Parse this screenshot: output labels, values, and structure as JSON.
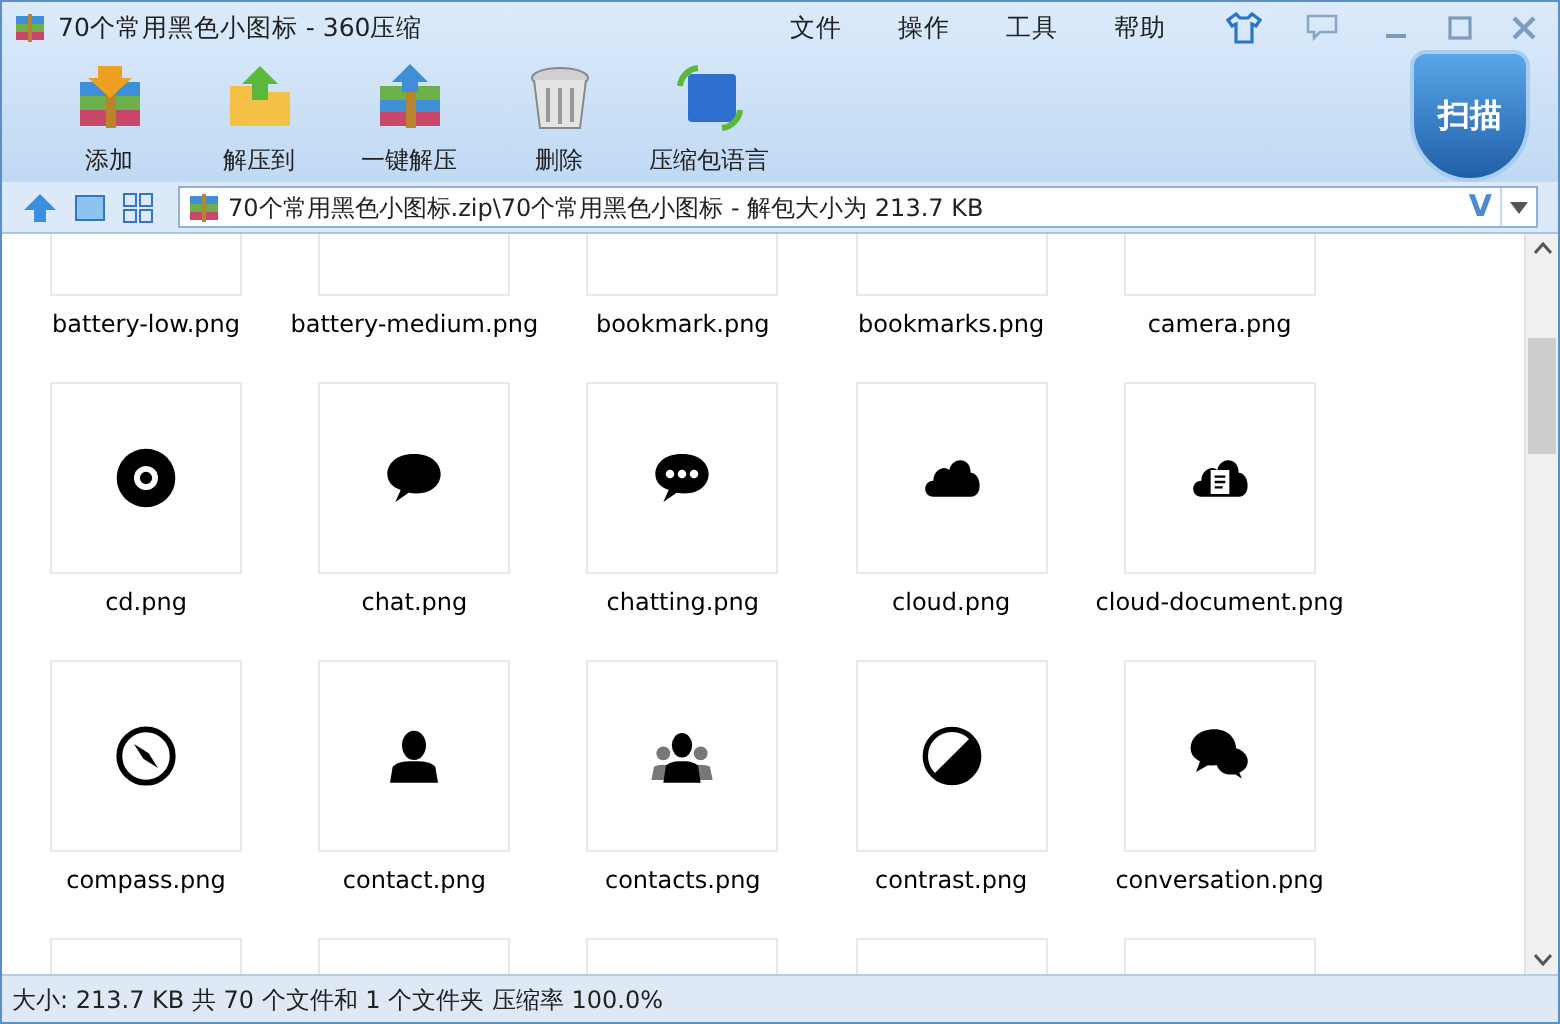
{
  "window": {
    "title": "70个常用黑色小图标 - 360压缩"
  },
  "menu": [
    "文件",
    "操作",
    "工具",
    "帮助"
  ],
  "toolbar": [
    {
      "label": "添加",
      "kind": "add"
    },
    {
      "label": "解压到",
      "kind": "extract_to"
    },
    {
      "label": "一键解压",
      "kind": "one_click"
    },
    {
      "label": "删除",
      "kind": "delete"
    },
    {
      "label": "压缩包语言",
      "kind": "language"
    }
  ],
  "scan_button": {
    "label": "扫描"
  },
  "address": {
    "value": "70个常用黑色小图标.zip\\70个常用黑色小图标 - 解包大小为 213.7 KB",
    "v_mark": "V"
  },
  "files": [
    {
      "name": "battery-low.png",
      "kind": "blank"
    },
    {
      "name": "battery-medium.png",
      "kind": "blank"
    },
    {
      "name": "bookmark.png",
      "kind": "blank"
    },
    {
      "name": "bookmarks.png",
      "kind": "blank"
    },
    {
      "name": "camera.png",
      "kind": "blank"
    },
    {
      "name": "cd.png",
      "kind": "cd"
    },
    {
      "name": "chat.png",
      "kind": "chat"
    },
    {
      "name": "chatting.png",
      "kind": "chatting"
    },
    {
      "name": "cloud.png",
      "kind": "cloud"
    },
    {
      "name": "cloud-document.png",
      "kind": "cloud_document"
    },
    {
      "name": "compass.png",
      "kind": "compass"
    },
    {
      "name": "contact.png",
      "kind": "contact"
    },
    {
      "name": "contacts.png",
      "kind": "contacts"
    },
    {
      "name": "contrast.png",
      "kind": "contrast"
    },
    {
      "name": "conversation.png",
      "kind": "conversation"
    },
    {
      "kind": "blank"
    },
    {
      "kind": "blank"
    },
    {
      "kind": "blank"
    },
    {
      "kind": "blank"
    },
    {
      "kind": "blank"
    }
  ],
  "status_bar": "大小: 213.7 KB 共 70 个文件和 1 个文件夹 压缩率 100.0%"
}
